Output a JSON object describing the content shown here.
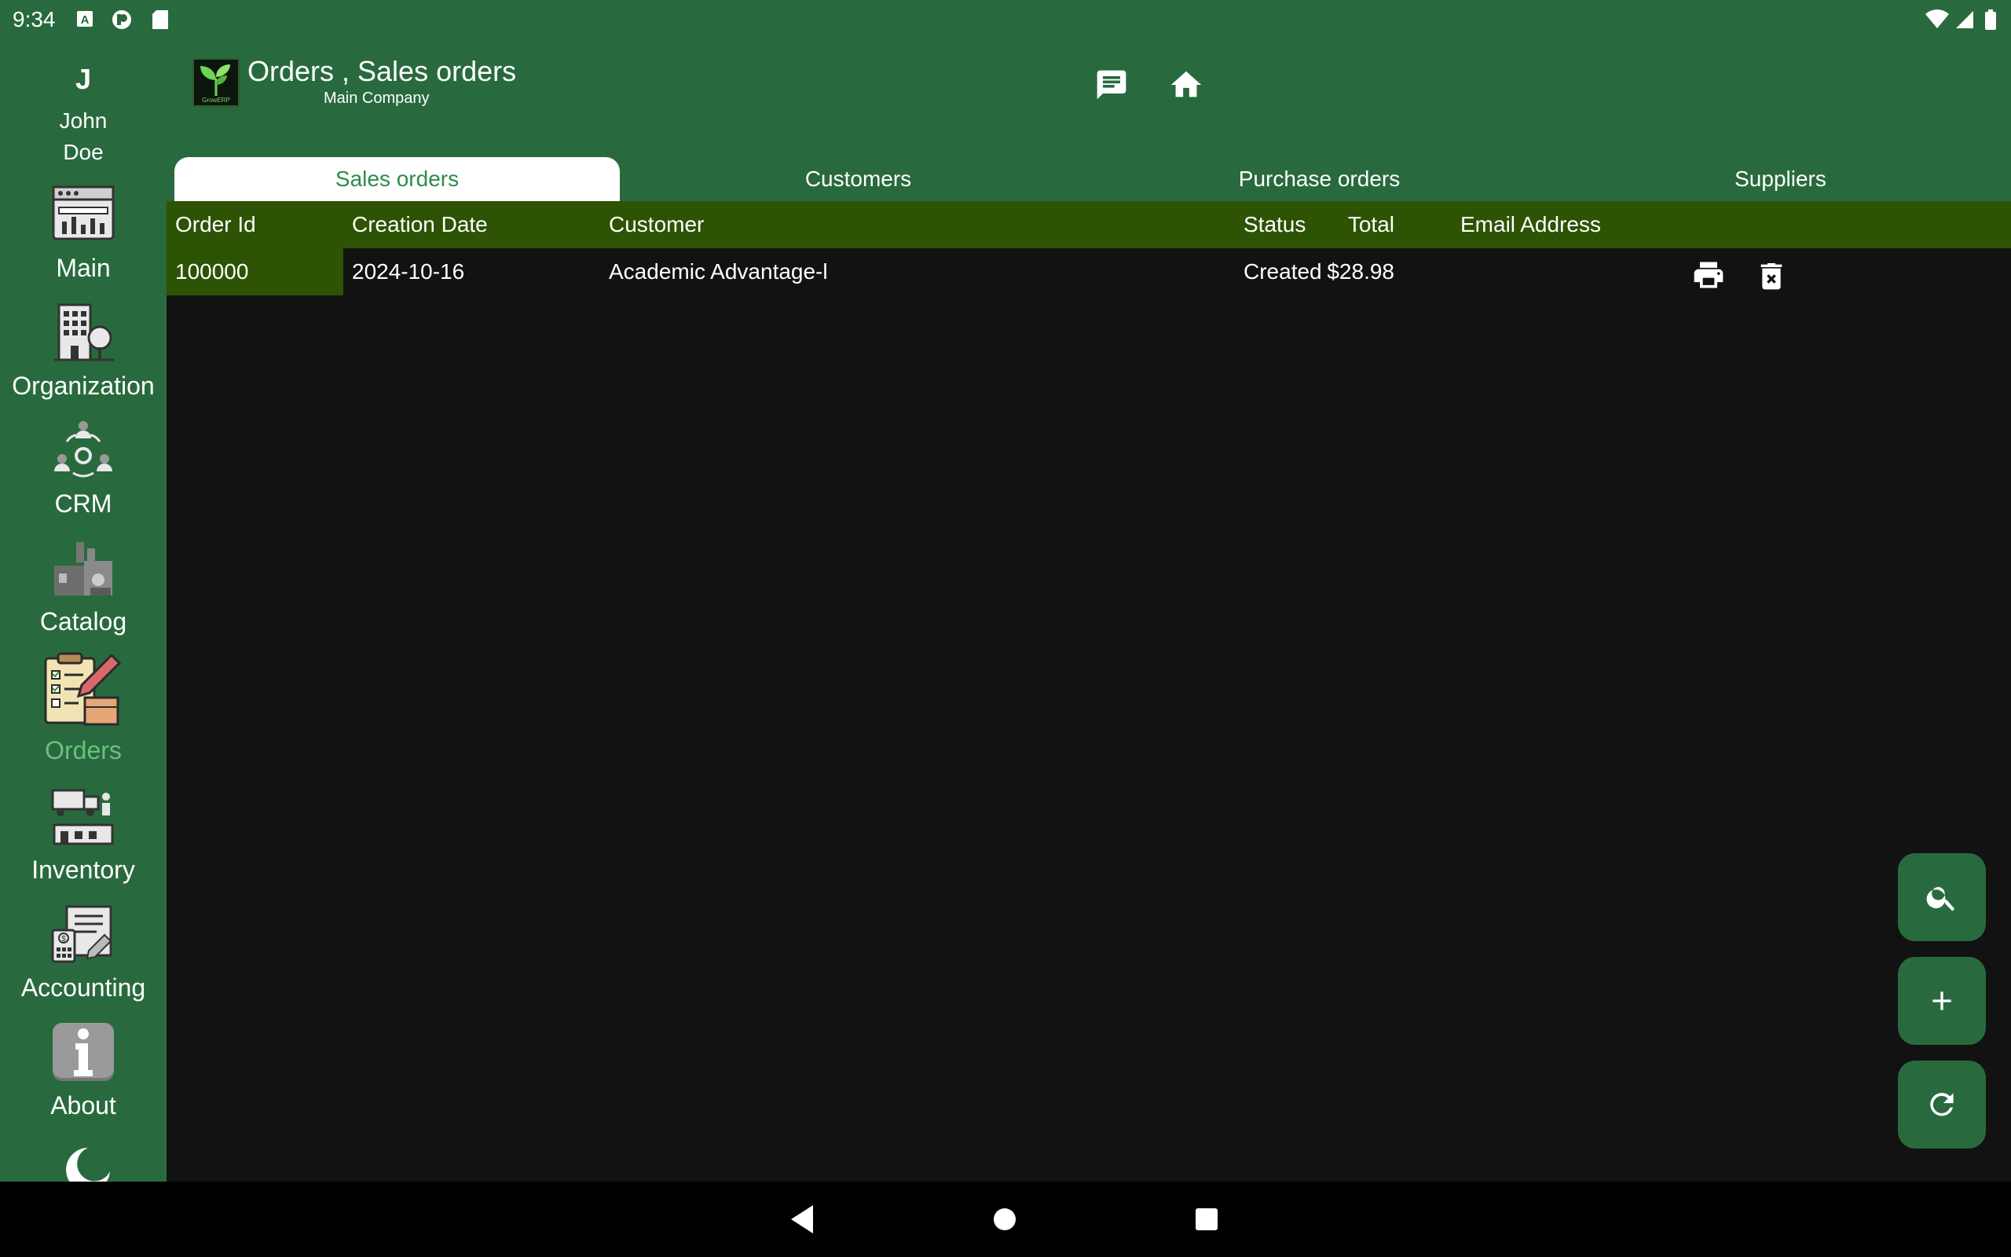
{
  "status_bar": {
    "time": "9:34"
  },
  "header": {
    "logo_text": "GrowERP",
    "title": "Orders , Sales orders",
    "subtitle": "Main Company"
  },
  "tabs": [
    {
      "label": "Sales orders",
      "active": true
    },
    {
      "label": "Customers",
      "active": false
    },
    {
      "label": "Purchase orders",
      "active": false
    },
    {
      "label": "Suppliers",
      "active": false
    }
  ],
  "user": {
    "initial": "J",
    "first_name": "John",
    "last_name": "Doe"
  },
  "sidebar": {
    "items": [
      {
        "label": "Main",
        "icon": "dashboard-icon"
      },
      {
        "label": "Organization",
        "icon": "building-icon"
      },
      {
        "label": "CRM",
        "icon": "people-network-icon"
      },
      {
        "label": "Catalog",
        "icon": "factory-icon"
      },
      {
        "label": "Orders",
        "icon": "clipboard-pencil-icon",
        "active": true
      },
      {
        "label": "Inventory",
        "icon": "warehouse-truck-icon"
      },
      {
        "label": "Accounting",
        "icon": "invoice-calculator-icon"
      },
      {
        "label": "About",
        "icon": "info-icon"
      }
    ]
  },
  "table": {
    "columns": [
      "Order Id",
      "Creation Date",
      "Customer",
      "Total",
      "Status",
      "Email Address"
    ],
    "rows": [
      {
        "order_id": "100000",
        "creation_date": "2024-10-16",
        "customer": "Academic Advantage-l",
        "total": "$28.98",
        "status": "Created",
        "email": ""
      }
    ]
  },
  "colors": {
    "primary": "#286a3e",
    "header_row": "#2d5304",
    "background": "#121212",
    "active_nav": "#6bbf7e"
  }
}
